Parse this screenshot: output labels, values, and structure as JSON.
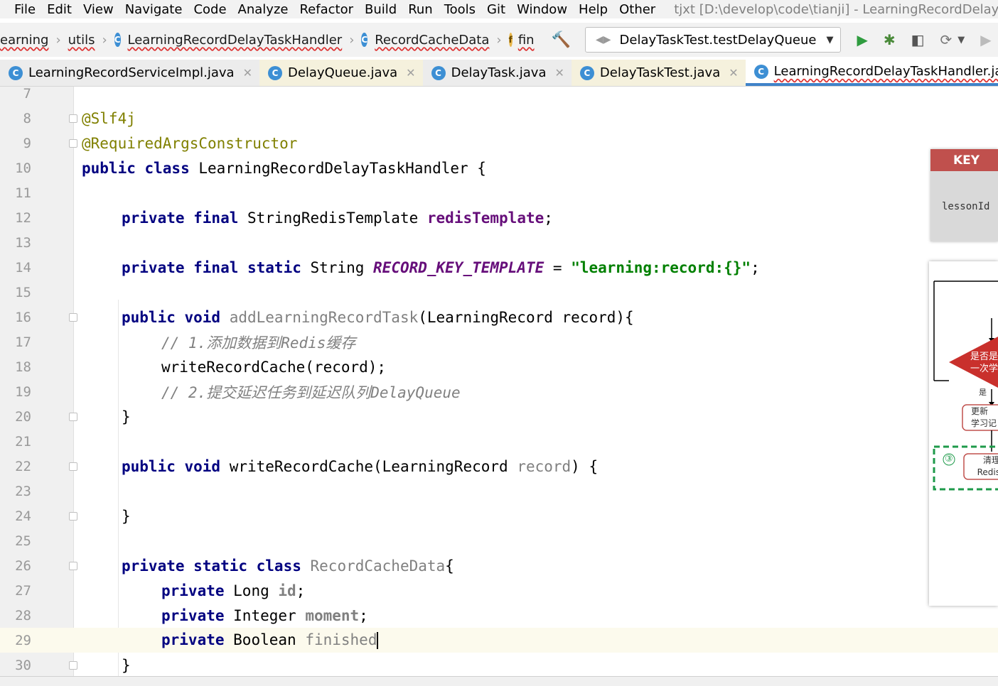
{
  "menubar": {
    "items": [
      "File",
      "Edit",
      "View",
      "Navigate",
      "Code",
      "Analyze",
      "Refactor",
      "Build",
      "Run",
      "Tools",
      "Git",
      "Window",
      "Help",
      "Other"
    ],
    "title": "tjxt [D:\\develop\\code\\tianji] - LearningRecordDelayTa"
  },
  "navbar": {
    "crumbs": [
      "earning",
      "utils",
      "LearningRecordDelayTaskHandler",
      "RecordCacheData",
      "fin"
    ],
    "run_config": "DelayTaskTest.testDelayQueue"
  },
  "tabs": [
    {
      "label": "LearningRecordServiceImpl.java",
      "state": "normal"
    },
    {
      "label": "DelayQueue.java",
      "state": "yellow"
    },
    {
      "label": "DelayTask.java",
      "state": "normal"
    },
    {
      "label": "DelayTaskTest.java",
      "state": "yellow"
    },
    {
      "label": "LearningRecordDelayTaskHandler.java",
      "state": "active"
    }
  ],
  "editor": {
    "line_numbers": [
      "7",
      "8",
      "9",
      "10",
      "11",
      "12",
      "13",
      "14",
      "15",
      "16",
      "17",
      "18",
      "19",
      "20",
      "21",
      "22",
      "23",
      "24",
      "25",
      "26",
      "27",
      "28",
      "29",
      "30"
    ],
    "current_line": "29",
    "code": {
      "l8_ann": "@Slf4j",
      "l9_ann": "@RequiredArgsConstructor",
      "l10_kw": "public class",
      "l10_rest": " LearningRecordDelayTaskHandler {",
      "l12_kw": "private final",
      "l12_type": " StringRedisTemplate ",
      "l12_field": "redisTemplate",
      "l12_end": ";",
      "l14_kw": "private final static",
      "l14_type": " String ",
      "l14_const": "RECORD_KEY_TEMPLATE",
      "l14_eq": " = ",
      "l14_str": "\"learning:record:{}\"",
      "l14_end": ";",
      "l16_kw": "public void",
      "l16_name": " addLearningRecordTask",
      "l16_rest": "(LearningRecord record){",
      "l17_comment": "// 1.添加数据到Redis缓存",
      "l18_code": "writeRecordCache(record);",
      "l19_comment": "// 2.提交延迟任务到延迟队列DelayQueue",
      "l20_code": "}",
      "l22_kw": "public void",
      "l22_rest": " writeRecordCache(LearningRecord ",
      "l22_param": "record",
      "l22_end": ") {",
      "l24_code": "}",
      "l26_kw": "private static class",
      "l26_name": " RecordCacheData",
      "l26_end": "{",
      "l27_kw": "private",
      "l27_type": " Long ",
      "l27_field": "id",
      "l27_end": ";",
      "l28_kw": "private",
      "l28_type": " Integer ",
      "l28_field": "moment",
      "l28_end": ";",
      "l29_kw": "private",
      "l29_type": " Boolean ",
      "l29_field": "finished",
      "l30_code": "}"
    }
  },
  "key_panel": {
    "header": "KEY",
    "value": "lessonId"
  },
  "flow_panel": {
    "decision": "是否是\n一次学",
    "yes_label": "是",
    "update_box": "更新\n学习记",
    "step_num": "③",
    "clear_box": "清理\nRedis"
  }
}
